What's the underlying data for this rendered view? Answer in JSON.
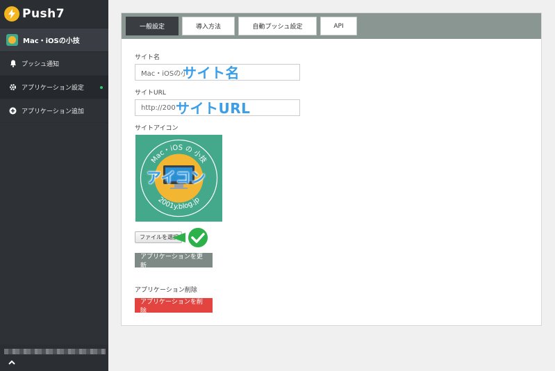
{
  "sidebar": {
    "brand": "Push7",
    "app_name": "Mac・iOSの小技",
    "items": [
      {
        "label": "プッシュ通知",
        "icon": "bell-icon"
      },
      {
        "label": "アプリケーション設定",
        "icon": "gear-icon"
      },
      {
        "label": "アプリケーション追加",
        "icon": "plus-circle-icon"
      }
    ]
  },
  "tabs": [
    {
      "label": "一般設定",
      "active": true
    },
    {
      "label": "導入方法",
      "active": false
    },
    {
      "label": "自動プッシュ設定",
      "active": false
    },
    {
      "label": "API",
      "active": false
    }
  ],
  "form": {
    "site_name_label": "サイト名",
    "site_name_value": "Mac・iOSの小",
    "site_url_label": "サイトURL",
    "site_url_value": "http://200",
    "site_icon_label": "サイトアイコン",
    "file_button": "ファイルを選択",
    "update_button": "アプリケーションを更新",
    "delete_section_label": "アプリケーション削除",
    "delete_button": "アプリケーションを削除"
  },
  "annotations": {
    "site_name": "サイト名",
    "site_url": "サイトURL",
    "icon": "アイコン"
  },
  "icon_image": {
    "ring_top": "Mac・iOS の 小技",
    "ring_bottom": "2001y.blog.jp"
  },
  "colors": {
    "sidebar": "#2e3136",
    "tabbar": "#8a9692",
    "active_tab": "#3a3d42",
    "update_button": "#7e8a86",
    "delete_button": "#e3443f",
    "annotation": "#3a9ee8",
    "check": "#2db14a"
  }
}
